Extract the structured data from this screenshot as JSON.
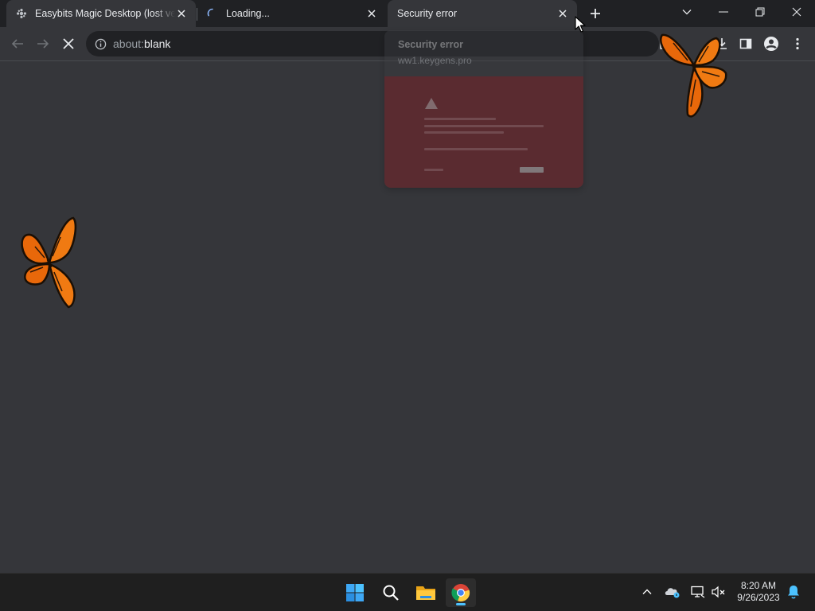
{
  "browser": {
    "tabs": [
      {
        "title": "Easybits Magic Desktop (lost vers",
        "favicon": "puzzle-icon",
        "active": false
      },
      {
        "title": "Loading...",
        "favicon": "spinner-icon",
        "active": false
      },
      {
        "title": "Security error",
        "favicon": "none",
        "active": true
      }
    ],
    "new_tab_icon": "plus-icon",
    "window_controls": [
      "chevron-down-icon",
      "minimize-icon",
      "restore-icon",
      "close-icon"
    ],
    "toolbar": {
      "back_icon": "arrow-left-icon",
      "forward_icon": "arrow-right-icon",
      "stop_icon": "close-icon",
      "url_scheme": "about:",
      "url_host": "blank",
      "right_icons": [
        "extension-icon",
        "download-icon",
        "side-panel-icon",
        "profile-icon",
        "kebab-menu-icon"
      ]
    },
    "hover_card": {
      "title": "Security error",
      "domain": "ww1.keygens.pro"
    }
  },
  "colors": {
    "tabstrip": "#202124",
    "toolbar": "#35363a",
    "content": "#35363a",
    "preview_red": "#8f1d24",
    "taskbar": "#1f1f1f",
    "accent": "#4cc2ff"
  },
  "taskbar": {
    "apps": [
      {
        "name": "windows-start-icon"
      },
      {
        "name": "search-icon"
      },
      {
        "name": "file-explorer-icon"
      },
      {
        "name": "chrome-icon",
        "active": true
      }
    ],
    "tray_icons": [
      "chevron-up-icon",
      "onedrive-icon",
      "network-icon",
      "volume-muted-icon",
      "notification-bell-icon"
    ],
    "clock": {
      "time": "8:20 AM",
      "date": "9/26/2023"
    }
  }
}
